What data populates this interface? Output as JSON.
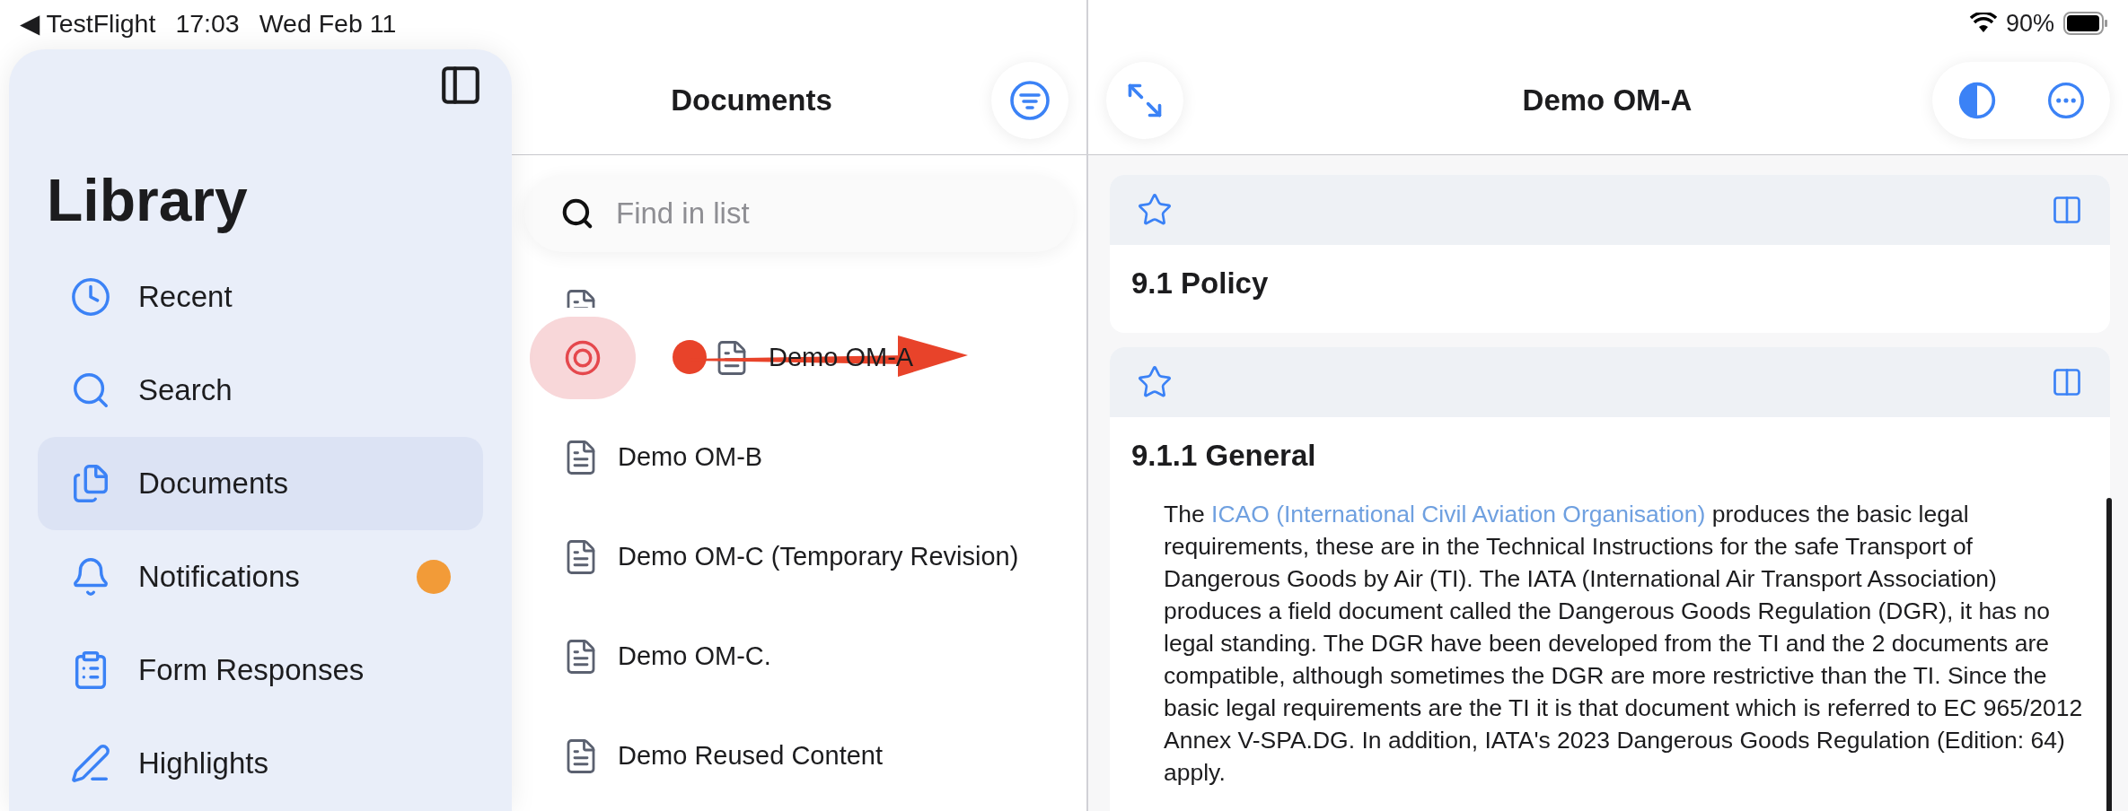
{
  "status_bar": {
    "back_glyph": "◀",
    "back_app": "TestFlight",
    "time": "17:03",
    "date": "Wed Feb 11",
    "battery": "90%"
  },
  "sidebar": {
    "title": "Library",
    "items": [
      {
        "label": "Recent",
        "selected": false,
        "unread": false
      },
      {
        "label": "Search",
        "selected": false,
        "unread": false
      },
      {
        "label": "Documents",
        "selected": true,
        "unread": false
      },
      {
        "label": "Notifications",
        "selected": false,
        "unread": true
      },
      {
        "label": "Form Responses",
        "selected": false,
        "unread": false
      },
      {
        "label": "Highlights",
        "selected": false,
        "unread": false
      }
    ]
  },
  "documents": {
    "title": "Documents",
    "search": {
      "placeholder": "Find in list"
    },
    "rows": [
      {
        "label": "Demo OM-A",
        "swiped": true
      },
      {
        "label": "Demo OM-B",
        "swiped": false
      },
      {
        "label": "Demo OM-C (Temporary Revision)",
        "swiped": false
      },
      {
        "label": "Demo OM-C.",
        "swiped": false
      },
      {
        "label": "Demo Reused Content",
        "swiped": false
      }
    ]
  },
  "viewer": {
    "title": "Demo OM-A",
    "sections": [
      {
        "heading": "9.1 Policy"
      },
      {
        "heading": "9.1.1 General",
        "paragraph": {
          "text_before": "The ",
          "link": "ICAO (International Civil Aviation Organisation)",
          "text_after": " produces the basic legal requirements, these are in the Technical Instructions for the safe Transport of Dangerous Goods by Air (TI). The IATA (International Air Transport Association) produces a field document called the Dangerous Goods Regulation (DGR), it has no legal standing. The DGR have been developed from the TI and the 2 documents are compatible, although sometimes the DGR are more restrictive than the TI. Since the basic legal requirements are the TI it is that document which is referred to EC 965/2012 Annex V-SPA.DG. In addition, IATA's 2023 Dangerous Goods Regulation (Edition: 64) apply."
        }
      }
    ]
  }
}
